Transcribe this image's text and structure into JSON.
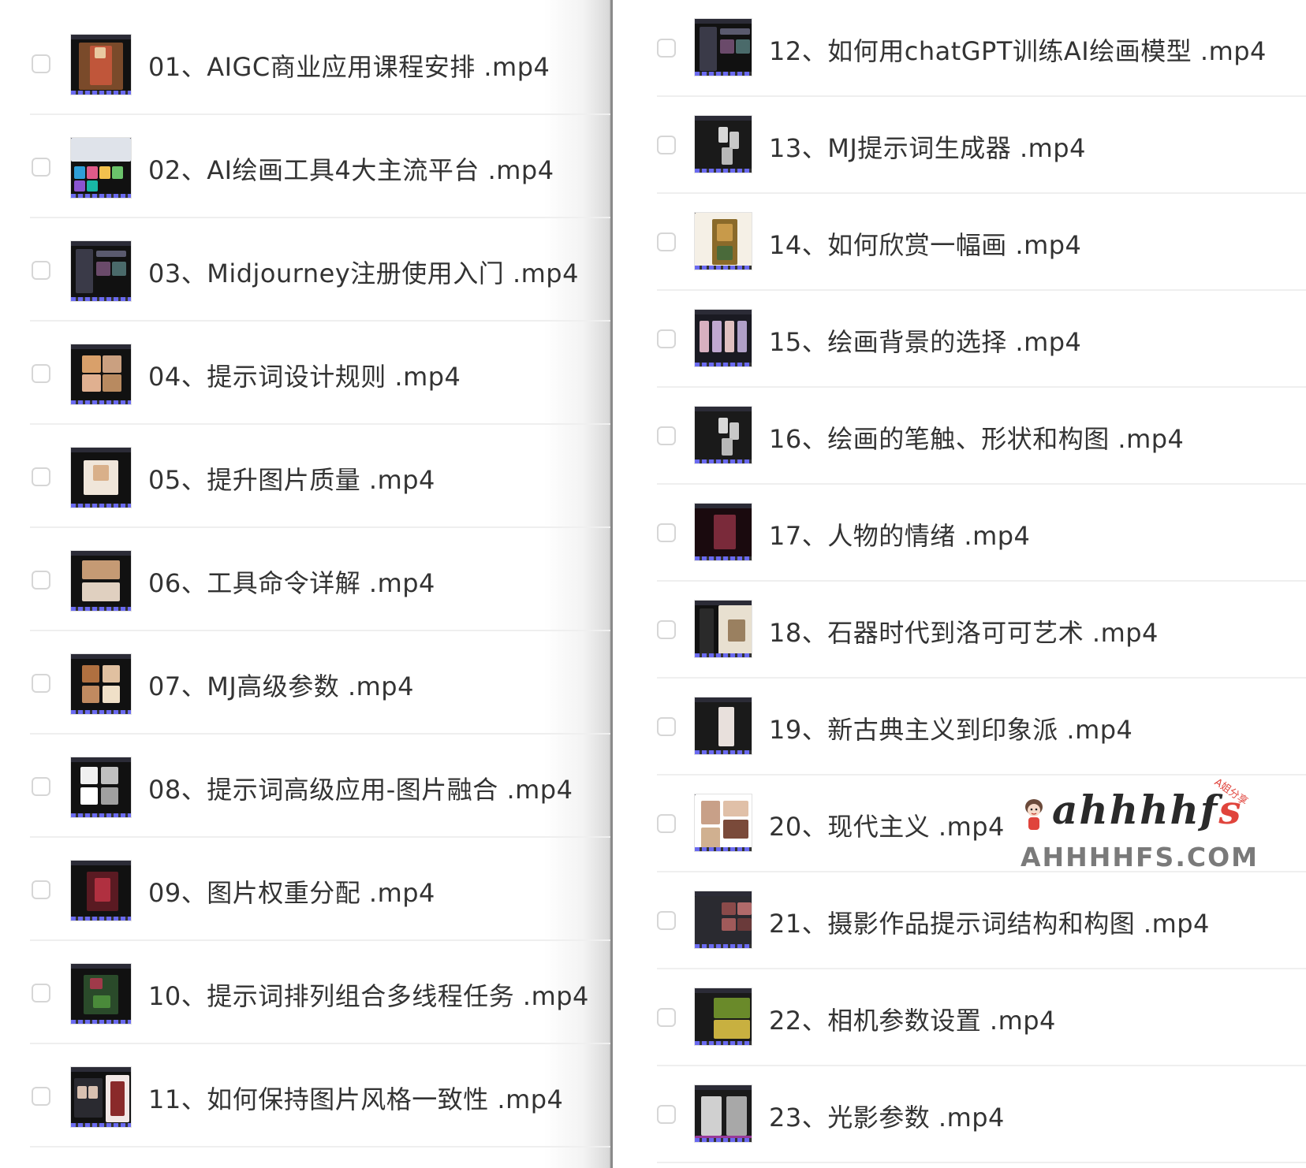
{
  "left_items": [
    {
      "label": "01、AIGC商业应用课程安排 .mp4",
      "thumb": "portrait-red"
    },
    {
      "label": "02、AI绘画工具4大主流平台 .mp4",
      "thumb": "collage-colorful"
    },
    {
      "label": "03、Midjourney注册使用入门 .mp4",
      "thumb": "dark-app"
    },
    {
      "label": "04、提示词设计规则 .mp4",
      "thumb": "cats-grid"
    },
    {
      "label": "05、提升图片质量 .mp4",
      "thumb": "cat-white"
    },
    {
      "label": "06、工具命令详解 .mp4",
      "thumb": "cats-pair"
    },
    {
      "label": "07、MJ高级参数 .mp4",
      "thumb": "dogs-grid"
    },
    {
      "label": "08、提示词高级应用-图片融合 .mp4",
      "thumb": "bw-grid"
    },
    {
      "label": "09、图片权重分配 .mp4",
      "thumb": "figure-red"
    },
    {
      "label": "10、提示词排列组合多线程任务 .mp4",
      "thumb": "flowers"
    },
    {
      "label": "11、如何保持图片风格一致性 .mp4",
      "thumb": "woman-portrait"
    }
  ],
  "right_items": [
    {
      "label": "12、如何用chatGPT训练AI绘画模型 .mp4",
      "thumb": "dark-app"
    },
    {
      "label": "13、MJ提示词生成器 .mp4",
      "thumb": "dark-figures"
    },
    {
      "label": "14、如何欣赏一幅画 .mp4",
      "thumb": "painting"
    },
    {
      "label": "15、绘画背景的选择 .mp4",
      "thumb": "figures-row"
    },
    {
      "label": "16、绘画的笔触、形状和构图 .mp4",
      "thumb": "dark-figures"
    },
    {
      "label": "17、人物的情绪 .mp4",
      "thumb": "dark-red"
    },
    {
      "label": "18、石器时代到洛可可艺术 .mp4",
      "thumb": "cave-art"
    },
    {
      "label": "19、新古典主义到印象派 .mp4",
      "thumb": "statue"
    },
    {
      "label": "20、现代主义 .mp4",
      "thumb": "collage-light"
    },
    {
      "label": "21、摄影作品提示词结构和构图 .mp4",
      "thumb": "photo-grid"
    },
    {
      "label": "22、相机参数设置 .mp4",
      "thumb": "green-yellow"
    },
    {
      "label": "23、光影参数 .mp4",
      "thumb": "portraits-bw"
    }
  ],
  "watermark": {
    "script": "ahhhhfs",
    "tag": "A姐分享",
    "domain": "AHHHHFS.COM"
  },
  "colors": {
    "text": "#333333",
    "checkbox_border": "#d6d6d6",
    "separator": "#efefef",
    "watermark_accent": "#e0443c"
  }
}
